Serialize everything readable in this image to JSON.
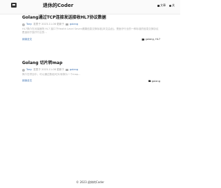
{
  "header": {
    "site_title": "退休的Coder",
    "nav": [
      {
        "label": "文章",
        "icon": "archive-icon"
      },
      {
        "label": "关",
        "icon": "about-icon"
      }
    ]
  },
  "posts": [
    {
      "title": "Golang通过TCP连接发送接收HL7协议数据",
      "author": "Tony",
      "date_text": "发表于 2023-11-08 更新于",
      "category": "golang",
      "excerpt": "HL7简介在对接医院 HL7 接口下Health Level Seven健康信息交换标准[本文由此]，是医疗行业的一种标准的信息交换协议是适用于医疗行业的...",
      "read_more": "阅读全文",
      "tags": "golang, HL7"
    },
    {
      "title": "Golang 切片转map",
      "author": "Tony",
      "date_text": "发表于 2023-11-08 更新于",
      "category": "golang",
      "excerpt": "简介在项目中，可以通过数组/切片转换为一个map...",
      "read_more": "阅读全文",
      "tags": "golang"
    }
  ],
  "footer": {
    "copyright": "© 2023 退休的Coder"
  }
}
